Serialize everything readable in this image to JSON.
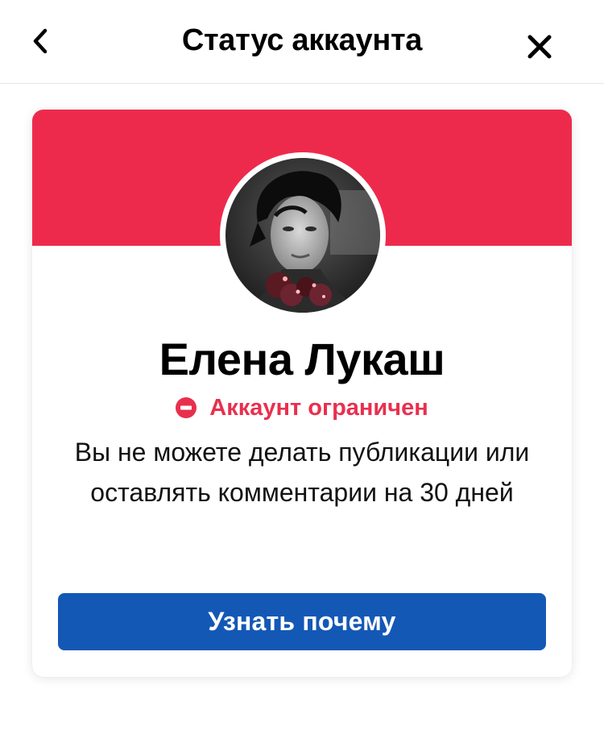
{
  "header": {
    "title": "Статус аккаунта",
    "back_icon": "chevron-left-icon",
    "close_icon": "close-icon"
  },
  "card": {
    "banner_color": "#EE2A4C",
    "avatar_icon": "profile-photo",
    "user_name": "Елена Лукаш",
    "status": {
      "icon": "no-entry-icon",
      "text": "Аккаунт ограничен",
      "color": "#E8304E"
    },
    "description": "Вы не можете делать публикации или оставлять комментарии на 30 дней",
    "button": {
      "label": "Узнать почему",
      "color": "#1458B6"
    }
  }
}
